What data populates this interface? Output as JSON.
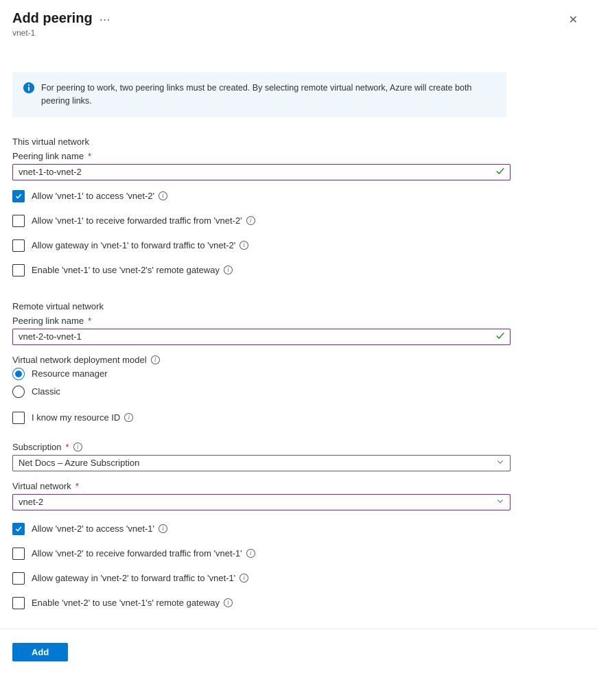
{
  "header": {
    "title": "Add peering",
    "subtitle": "vnet-1"
  },
  "banner": {
    "text": "For peering to work, two peering links must be created. By selecting remote virtual network, Azure will create both peering links."
  },
  "thisVnet": {
    "sectionTitle": "This virtual network",
    "peeringLinkLabel": "Peering link name",
    "peeringLinkValue": "vnet-1-to-vnet-2",
    "checkboxes": [
      {
        "label": "Allow 'vnet-1' to access 'vnet-2'",
        "checked": true
      },
      {
        "label": "Allow 'vnet-1' to receive forwarded traffic from 'vnet-2'",
        "checked": false
      },
      {
        "label": "Allow gateway in 'vnet-1' to forward traffic to 'vnet-2'",
        "checked": false
      },
      {
        "label": "Enable 'vnet-1' to use 'vnet-2's' remote gateway",
        "checked": false
      }
    ]
  },
  "remoteVnet": {
    "sectionTitle": "Remote virtual network",
    "peeringLinkLabel": "Peering link name",
    "peeringLinkValue": "vnet-2-to-vnet-1",
    "modelLabel": "Virtual network deployment model",
    "modelOptions": [
      {
        "label": "Resource manager",
        "selected": true
      },
      {
        "label": "Classic",
        "selected": false
      }
    ],
    "knowIdLabel": "I know my resource ID",
    "knowIdChecked": false,
    "subscriptionLabel": "Subscription",
    "subscriptionValue": "Net Docs – Azure Subscription",
    "vnetLabel": "Virtual network",
    "vnetValue": "vnet-2",
    "checkboxes": [
      {
        "label": "Allow 'vnet-2' to access 'vnet-1'",
        "checked": true
      },
      {
        "label": "Allow 'vnet-2' to receive forwarded traffic from 'vnet-1'",
        "checked": false
      },
      {
        "label": "Allow gateway in 'vnet-2' to forward traffic to 'vnet-1'",
        "checked": false
      },
      {
        "label": "Enable 'vnet-2' to use 'vnet-1's' remote gateway",
        "checked": false
      }
    ]
  },
  "footer": {
    "addLabel": "Add"
  }
}
